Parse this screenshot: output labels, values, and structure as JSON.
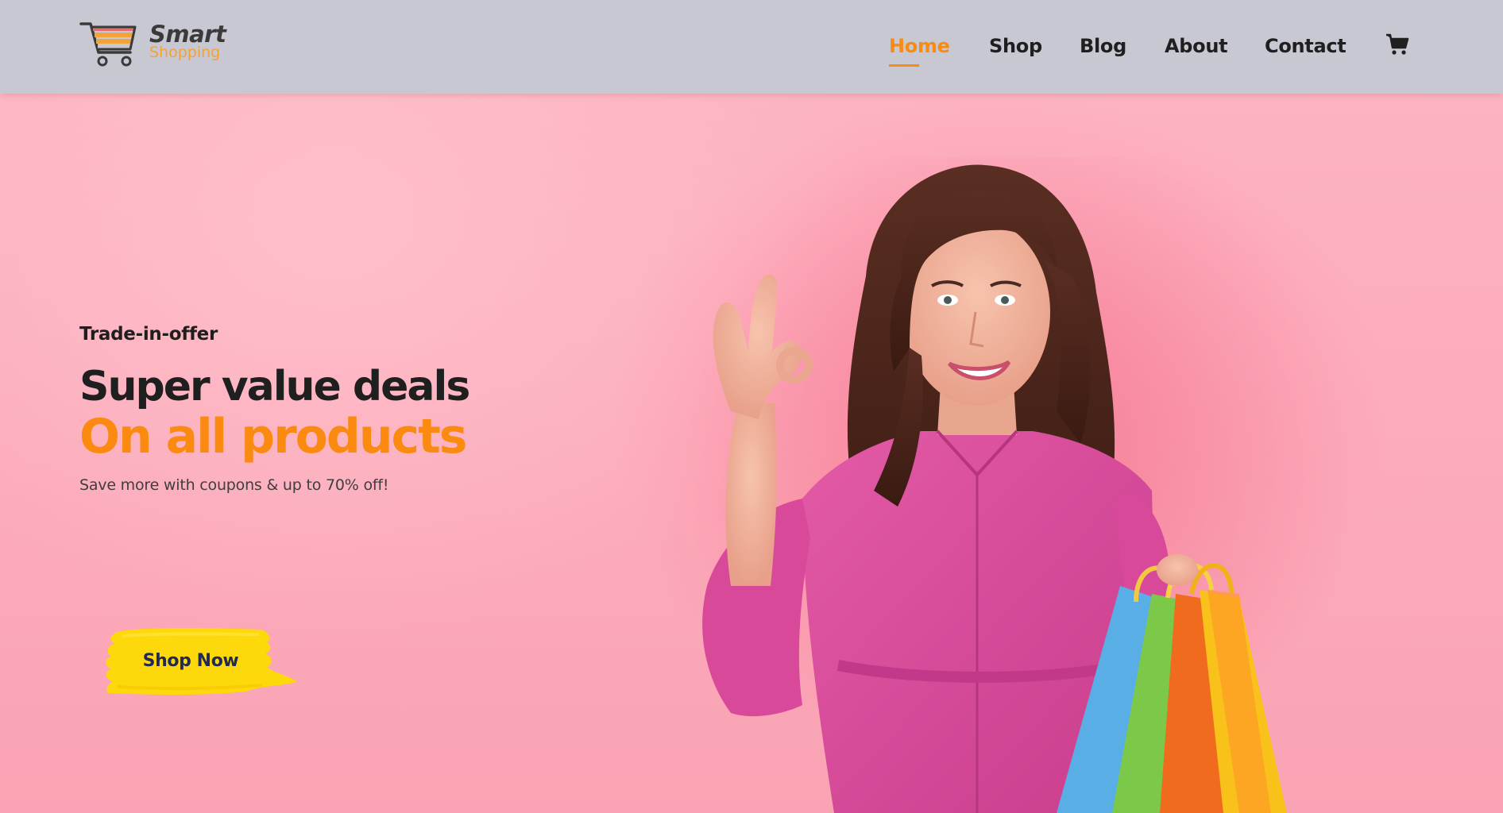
{
  "brand": {
    "name": "Smart",
    "tagline": "Shopping"
  },
  "nav": {
    "items": [
      {
        "label": "Home",
        "active": true
      },
      {
        "label": "Shop",
        "active": false
      },
      {
        "label": "Blog",
        "active": false
      },
      {
        "label": "About",
        "active": false
      },
      {
        "label": "Contact",
        "active": false
      }
    ],
    "cart_icon": "shopping-cart-icon"
  },
  "hero": {
    "kicker": "Trade-in-offer",
    "title_line1": "Super value deals",
    "title_line2": "On all products",
    "subtitle": "Save more with coupons & up to 70% off!",
    "cta_label": "Shop Now"
  },
  "colors": {
    "accent": "#fb8a11",
    "header_bg": "#c7c8d1",
    "hero_bg": "#fba8b8",
    "cta_bg": "#fdd80b",
    "cta_text": "#222a52"
  }
}
